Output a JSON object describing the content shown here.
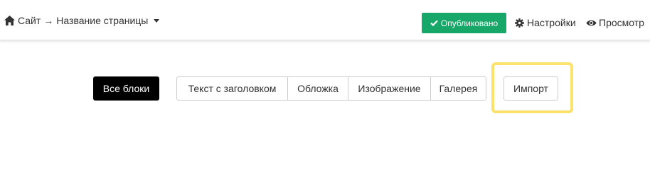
{
  "header": {
    "home_icon": "home-icon",
    "site_label": "Сайт",
    "arrow": "→",
    "page_name": "Название страницы",
    "dropdown_icon": "caret-down-icon",
    "published_label": "Опубликовано",
    "published_icon": "check-icon",
    "settings_label": "Настройки",
    "settings_icon": "gear-icon",
    "preview_label": "Просмотр",
    "preview_icon": "eye-icon"
  },
  "filters": {
    "all_blocks_label": "Все блоки",
    "segments": [
      {
        "label": "Текст с заголовком"
      },
      {
        "label": "Обложка"
      },
      {
        "label": "Изображение"
      },
      {
        "label": "Галерея"
      }
    ],
    "import_label": "Импорт"
  },
  "colors": {
    "published_bg": "#17a768",
    "all_blocks_bg": "#000000",
    "highlight_border": "#fbe26a"
  }
}
